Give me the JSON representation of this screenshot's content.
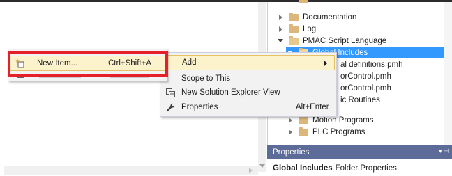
{
  "solution_explorer": {
    "items": [
      {
        "label": "Documentation",
        "expander": "collapsed"
      },
      {
        "label": "Log",
        "expander": "collapsed"
      },
      {
        "label": "PMAC Script Language",
        "expander": "expanded"
      },
      {
        "label": "Global Includes",
        "expander": "expanded",
        "selected": true
      },
      {
        "label": "al definitions.pmh"
      },
      {
        "label": "orControl.pmh"
      },
      {
        "label": "orControl.pmh"
      },
      {
        "label": "ic Routines"
      },
      {
        "label": "Motion Programs",
        "expander": "collapsed"
      },
      {
        "label": "PLC Programs",
        "expander": "collapsed"
      }
    ]
  },
  "context_menu": {
    "add": {
      "label": "Add"
    },
    "scope": {
      "label": "Scope to This"
    },
    "new_view": {
      "label": "New Solution Explorer View"
    },
    "properties": {
      "label": "Properties",
      "shortcut": "Alt+Enter"
    }
  },
  "submenu": {
    "new_item": {
      "label": "New Item...",
      "shortcut": "Ctrl+Shift+A"
    }
  },
  "properties_panel": {
    "title": "Properties",
    "subject_bold": "Global Includes",
    "subject_rest": "Folder Properties"
  },
  "colors": {
    "selection": "#3399ff",
    "highlight_red": "#e5202b",
    "menu_hover": "#fcf3cc",
    "panel_header": "#5d6b99",
    "folder": "#dcb67a"
  }
}
